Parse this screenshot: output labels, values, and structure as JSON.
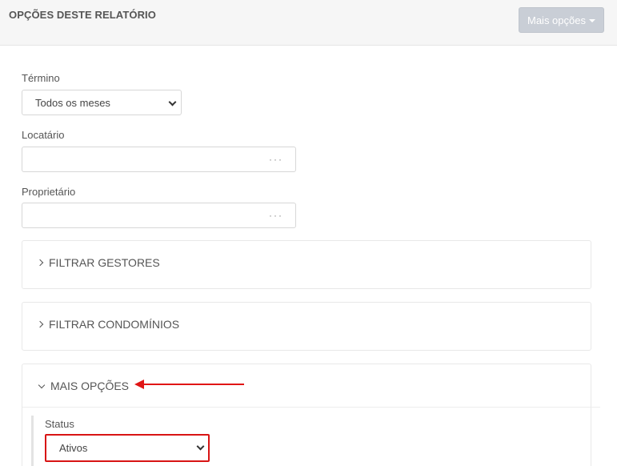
{
  "header": {
    "title": "OPÇÕES DESTE RELATÓRIO",
    "more_button_label": "Mais opções"
  },
  "form": {
    "termino": {
      "label": "Término",
      "selected": "Todos os meses"
    },
    "locatario": {
      "label": "Locatário",
      "value": "",
      "lookup_glyph": "···"
    },
    "proprietario": {
      "label": "Proprietário",
      "value": "",
      "lookup_glyph": "···"
    }
  },
  "panels": [
    {
      "title": "FILTRAR GESTORES",
      "expanded": false
    },
    {
      "title": "FILTRAR CONDOMÍNIOS",
      "expanded": false
    },
    {
      "title": "MAIS OPÇÕES",
      "expanded": true
    }
  ],
  "mais_opcoes": {
    "status": {
      "label": "Status",
      "selected": "Ativos"
    }
  },
  "annotations": {
    "accent_color": "#e01515"
  }
}
